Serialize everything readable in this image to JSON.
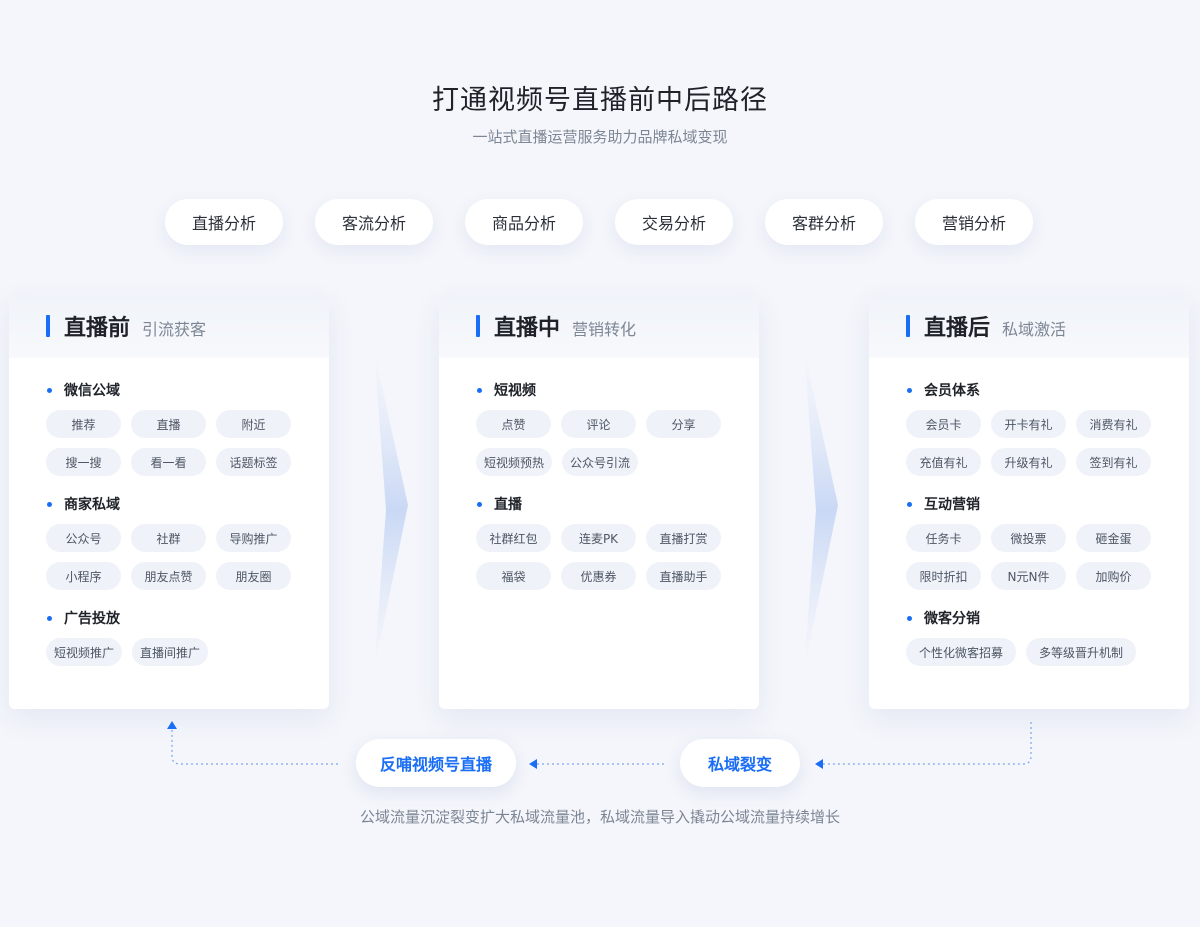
{
  "header": {
    "title": "打通视频号直播前中后路径",
    "subtitle": "一站式直播运营服务助力品牌私域变现"
  },
  "analysis_tabs": [
    "直播分析",
    "客流分析",
    "商品分析",
    "交易分析",
    "客群分析",
    "营销分析"
  ],
  "cards": [
    {
      "title": "直播前",
      "subtitle": "引流获客",
      "sections": [
        {
          "name": "微信公域",
          "tags": [
            "推荐",
            "直播",
            "附近",
            "搜一搜",
            "看一看",
            "话题标签"
          ]
        },
        {
          "name": "商家私域",
          "tags": [
            "公众号",
            "社群",
            "导购推广",
            "小程序",
            "朋友点赞",
            "朋友圈"
          ]
        },
        {
          "name": "广告投放",
          "tags": [
            "短视频推广",
            "直播间推广"
          ]
        }
      ]
    },
    {
      "title": "直播中",
      "subtitle": "营销转化",
      "sections": [
        {
          "name": "短视频",
          "tags": [
            "点赞",
            "评论",
            "分享",
            "短视频预热",
            "公众号引流"
          ]
        },
        {
          "name": "直播",
          "tags": [
            "社群红包",
            "连麦PK",
            "直播打赏",
            "福袋",
            "优惠券",
            "直播助手"
          ]
        }
      ]
    },
    {
      "title": "直播后",
      "subtitle": "私域激活",
      "sections": [
        {
          "name": "会员体系",
          "tags": [
            "会员卡",
            "开卡有礼",
            "消费有礼",
            "充值有礼",
            "升级有礼",
            "签到有礼"
          ]
        },
        {
          "name": "互动营销",
          "tags": [
            "任务卡",
            "微投票",
            "砸金蛋",
            "限时折扣",
            "N元N件",
            "加购价"
          ]
        },
        {
          "name": "微客分销",
          "tags": [
            "个性化微客招募",
            "多等级晋升机制"
          ]
        }
      ]
    }
  ],
  "flow": {
    "left_label": "反哺视频号直播",
    "right_label": "私域裂变",
    "footnote": "公域流量沉淀裂变扩大私域流量池，私域流量导入撬动公域流量持续增长"
  },
  "colors": {
    "accent": "#1a6ef5",
    "background": "#f4f6fb",
    "tag_bg": "#eff2f8"
  }
}
